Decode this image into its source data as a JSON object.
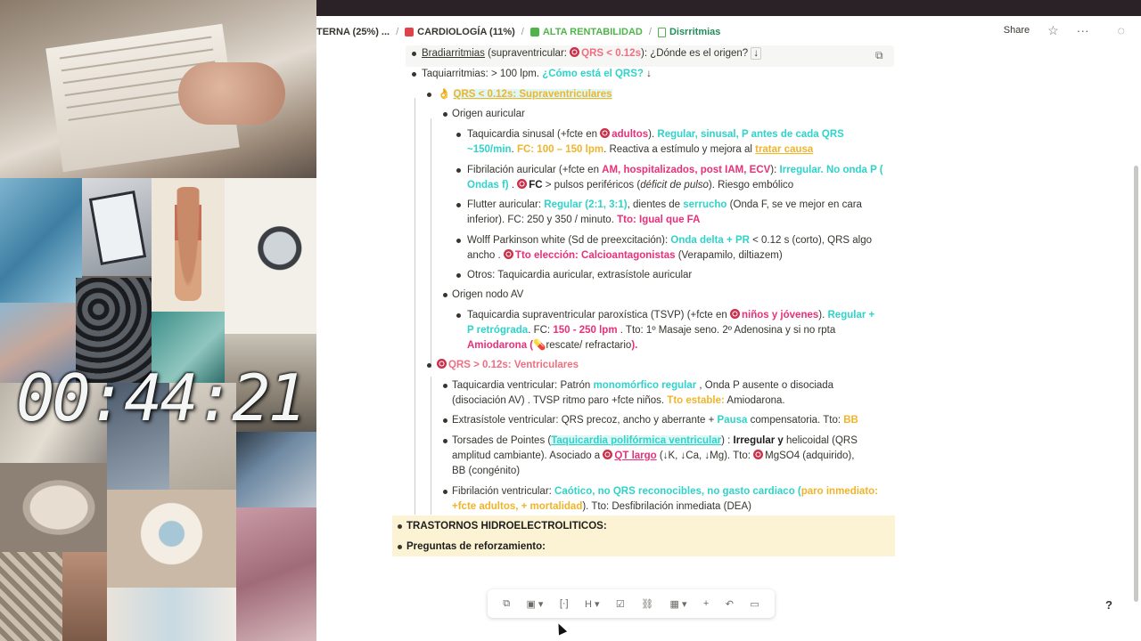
{
  "timer": "00:44:21",
  "breadcrumb": {
    "first": "TERNA (25%) ...",
    "second": "CARDIOLOGÍA (11%)",
    "third": "ALTA RENTABILIDAD",
    "fourth": "Disrritmias"
  },
  "top_actions": {
    "share": "Share"
  },
  "lines": {
    "l1_a": "Bradiarritmias",
    "l1_b": " (supraventricular: ",
    "l1_c": "QRS < 0.12s",
    "l1_d": "):  ¿Dónde es el origen?",
    "l1_e": "↓",
    "l2_a": "Taquiarritmias: > 100 lpm. ",
    "l2_b": "¿Cómo está el QRS?",
    "l2_c": " ↓",
    "l3_emoji": "👌",
    "l3_a": "QRS < 0.12s: Supraventriculares",
    "l4": "Origen auricular",
    "l5_a": "Taquicardia sinusal (+fcte en ",
    "l5_b": "adultos",
    "l5_c": "). ",
    "l5_d": "Regular, sinusal, P antes de cada  QRS",
    "l6_a": "~150/min",
    "l6_b": ". ",
    "l6_c": "FC: 100 – 150 lpm",
    "l6_d": ".  Reactiva a estímulo y mejora al ",
    "l6_e": "tratar causa",
    "l7_a": "Fibrilación auricular (+fcte en ",
    "l7_b": "AM, hospitalizados, post IAM, ECV",
    "l7_c": "): ",
    "l7_d": "Irregular. No onda P (",
    "l8_a": "Ondas f)",
    "l8_b": " . ",
    "l8_c": "FC",
    "l8_d": " > pulsos periféricos (",
    "l8_e": "déficit de pulso",
    "l8_f": ").  Riesgo embólico",
    "l9_a": "Flutter auricular: ",
    "l9_b": "Regular (2:1, 3:1)",
    "l9_c": ", dientes de ",
    "l9_d": "serrucho",
    "l9_e": "  (Onda F, se ve mejor en cara",
    "l10_a": "inferior).  FC: 250 y  350 / minuto. ",
    "l10_b": "Tto: Igual que FA",
    "l11_a": "Wolff Parkinson white (Sd de preexcitación): ",
    "l11_b": "Onda delta + PR",
    "l11_c": " < 0.12 s (corto),  QRS algo",
    "l12_a": "ancho    . ",
    "l12_b": "Tto elección: Calcioantagonistas",
    "l12_c": " (Verapamilo, diltiazem)",
    "l13": "Otros:  Taquicardia auricular, extrasístole auricular",
    "l14": "Origen nodo AV",
    "l15_a": "Taquicardia supraventricular paroxística (TSVP) (+fcte en ",
    "l15_b": "niños y jóvenes",
    "l15_c": "). ",
    "l15_d": "Regular +",
    "l16_a": "P retrógrada",
    "l16_b": ".  FC: ",
    "l16_c": "150 - 250 lpm",
    "l16_d": "  . Tto: 1º Masaje seno. 2º Adenosina  y si no rpta",
    "l17_a": "Amiodarona (",
    "l17_b": "💊",
    "l17_c": "rescate/ refractario",
    "l17_d": ").",
    "l18": "QRS > 0.12s: Ventriculares",
    "l19_a": "Taquicardia ventricular: Patrón ",
    "l19_b": "monomórfico regular",
    "l19_c": " , Onda P ausente o disociada",
    "l20_a": "(disociación AV)  . TVSP ritmo paro +fcte niños. ",
    "l20_b": "Tto estable:",
    "l20_c": " Amiodarona.",
    "l21_a": "Extrasístole ventricular:  QRS precoz, ancho y aberrante  + ",
    "l21_b": "Pausa",
    "l21_c": " compensatoria. Tto: ",
    "l21_d": "BB",
    "l22_a": "Torsades de Pointes (",
    "l22_b": "Taquicardia polifórmica ventricular",
    "l22_c": ") : ",
    "l22_d": "Irregular y",
    "l22_e": " helicoidal (QRS",
    "l23_a": "amplitud cambiante). Asociado a ",
    "l23_b": "QT largo",
    "l23_c": " (↓K, ↓Ca, ↓Mg).  Tto:  ",
    "l23_d": "MgSO4 (adquirido),",
    "l24": "BB (congénito)",
    "l25_a": "Fibrilación ventricular: ",
    "l25_b": "Caótico, no QRS reconocibles, no gasto cardiaco (",
    "l25_c": "paro inmediato:",
    "l26_a": "+fcte adultos, + mortalidad",
    "l26_b": "). Tto: Desfibrilación inmediata (DEA)",
    "l27": "TRASTORNOS HIDROELECTROLITICOS:",
    "l28": "Preguntas de reforzamiento:"
  },
  "help": "?",
  "colors": {
    "cyan": "#2fd3c9",
    "yellow": "#f0b429",
    "pink": "#e8307a",
    "salmon": "#ef6f82"
  }
}
